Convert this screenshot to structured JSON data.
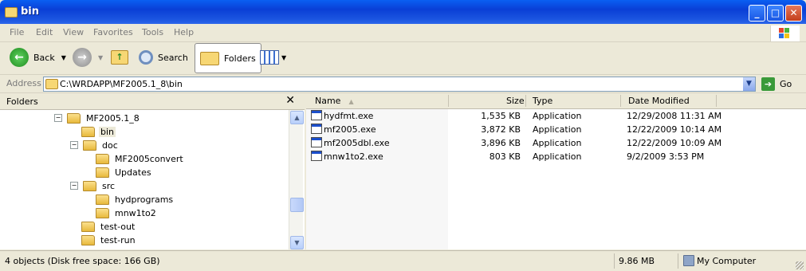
{
  "window": {
    "title": "bin"
  },
  "menu": [
    "File",
    "Edit",
    "View",
    "Favorites",
    "Tools",
    "Help"
  ],
  "toolbar": {
    "back": "Back",
    "search": "Search",
    "folders": "Folders"
  },
  "address": {
    "label": "Address",
    "path": "C:\\WRDAPP\\MF2005.1_8\\bin",
    "go": "Go"
  },
  "folder_pane": {
    "title": "Folders",
    "tree": [
      {
        "label": "MF2005.1_8",
        "expander": "−",
        "level": 0
      },
      {
        "label": "bin",
        "expander": "",
        "level": 1,
        "selected": true
      },
      {
        "label": "doc",
        "expander": "−",
        "level": 1
      },
      {
        "label": "MF2005convert",
        "expander": "",
        "level": 2
      },
      {
        "label": "Updates",
        "expander": "",
        "level": 2
      },
      {
        "label": "src",
        "expander": "−",
        "level": 1
      },
      {
        "label": "hydprograms",
        "expander": "",
        "level": 2
      },
      {
        "label": "mnw1to2",
        "expander": "",
        "level": 2
      },
      {
        "label": "test-out",
        "expander": "",
        "level": 1
      },
      {
        "label": "test-run",
        "expander": "",
        "level": 1
      }
    ]
  },
  "file_list": {
    "columns": {
      "name": "Name",
      "size": "Size",
      "type": "Type",
      "modified": "Date Modified"
    },
    "rows": [
      {
        "name": "hydfmt.exe",
        "size": "1,535 KB",
        "type": "Application",
        "modified": "12/29/2008 11:31 AM"
      },
      {
        "name": "mf2005.exe",
        "size": "3,872 KB",
        "type": "Application",
        "modified": "12/22/2009 10:14 AM"
      },
      {
        "name": "mf2005dbl.exe",
        "size": "3,896 KB",
        "type": "Application",
        "modified": "12/22/2009 10:09 AM"
      },
      {
        "name": "mnw1to2.exe",
        "size": "803 KB",
        "type": "Application",
        "modified": "9/2/2009 3:53 PM"
      }
    ]
  },
  "status": {
    "objects": "4 objects (Disk free space: 166 GB)",
    "size": "9.86 MB",
    "location": "My Computer"
  },
  "colors": {
    "titlebar": "#0a49e0",
    "chrome": "#ece9d8",
    "folder": "#f7d774"
  }
}
